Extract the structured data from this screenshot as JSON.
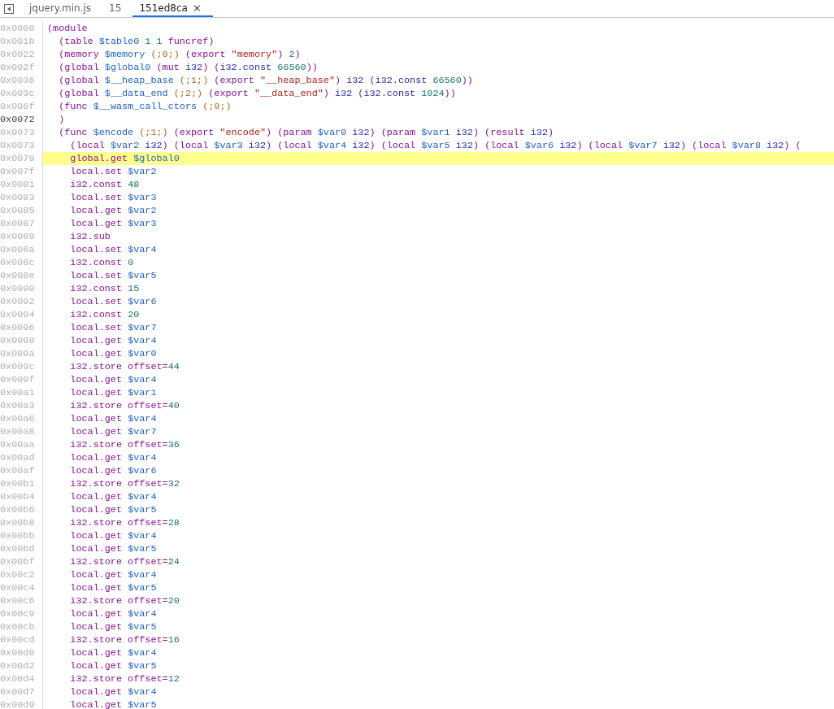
{
  "tabs": [
    {
      "label": "jquery.min.js",
      "selected": false
    },
    {
      "label": "15",
      "selected": false
    },
    {
      "label": "151ed8ca",
      "selected": true,
      "close": "×"
    }
  ],
  "code": {
    "lines": [
      {
        "addr": "0x0000",
        "dim": true,
        "current": false,
        "tokens": [
          {
            "kind": "keyword",
            "text": "(module"
          }
        ]
      },
      {
        "addr": "0x001b",
        "dim": true,
        "current": false,
        "tokens": [
          {
            "kind": "keyword",
            "text": "  (table "
          },
          {
            "kind": "name",
            "text": "$table0 "
          },
          {
            "kind": "number",
            "text": "1 1 "
          },
          {
            "kind": "keyword",
            "text": "funcref)"
          }
        ]
      },
      {
        "addr": "0x0022",
        "dim": true,
        "current": false,
        "tokens": [
          {
            "kind": "keyword",
            "text": "  (memory "
          },
          {
            "kind": "name",
            "text": "$memory "
          },
          {
            "kind": "comment",
            "text": "(;0;) "
          },
          {
            "kind": "keyword",
            "text": "(export "
          },
          {
            "kind": "string",
            "text": "\"memory\""
          },
          {
            "kind": "keyword",
            "text": ") "
          },
          {
            "kind": "number",
            "text": "2"
          },
          {
            "kind": "keyword",
            "text": ")"
          }
        ]
      },
      {
        "addr": "0x002f",
        "dim": true,
        "current": false,
        "tokens": [
          {
            "kind": "keyword",
            "text": "  (global "
          },
          {
            "kind": "name",
            "text": "$global0 "
          },
          {
            "kind": "keyword",
            "text": "(mut "
          },
          {
            "kind": "type",
            "text": "i32"
          },
          {
            "kind": "keyword",
            "text": ") ("
          },
          {
            "kind": "type",
            "text": "i32.const "
          },
          {
            "kind": "number",
            "text": "66560"
          },
          {
            "kind": "keyword",
            "text": "))"
          }
        ]
      },
      {
        "addr": "0x0036",
        "dim": true,
        "current": false,
        "tokens": [
          {
            "kind": "keyword",
            "text": "  (global "
          },
          {
            "kind": "name",
            "text": "$__heap_base "
          },
          {
            "kind": "comment",
            "text": "(;1;) "
          },
          {
            "kind": "keyword",
            "text": "(export "
          },
          {
            "kind": "string",
            "text": "\"__heap_base\""
          },
          {
            "kind": "keyword",
            "text": ") "
          },
          {
            "kind": "type",
            "text": "i32 "
          },
          {
            "kind": "keyword",
            "text": "("
          },
          {
            "kind": "type",
            "text": "i32.const "
          },
          {
            "kind": "number",
            "text": "66560"
          },
          {
            "kind": "keyword",
            "text": "))"
          }
        ]
      },
      {
        "addr": "0x003c",
        "dim": true,
        "current": false,
        "tokens": [
          {
            "kind": "keyword",
            "text": "  (global "
          },
          {
            "kind": "name",
            "text": "$__data_end "
          },
          {
            "kind": "comment",
            "text": "(;2;) "
          },
          {
            "kind": "keyword",
            "text": "(export "
          },
          {
            "kind": "string",
            "text": "\"__data_end\""
          },
          {
            "kind": "keyword",
            "text": ") "
          },
          {
            "kind": "type",
            "text": "i32 "
          },
          {
            "kind": "keyword",
            "text": "("
          },
          {
            "kind": "type",
            "text": "i32.const "
          },
          {
            "kind": "number",
            "text": "1024"
          },
          {
            "kind": "keyword",
            "text": "))"
          }
        ]
      },
      {
        "addr": "0x006f",
        "dim": true,
        "current": false,
        "tokens": [
          {
            "kind": "keyword",
            "text": "  (func "
          },
          {
            "kind": "name",
            "text": "$__wasm_call_ctors "
          },
          {
            "kind": "comment",
            "text": "(;0;)"
          }
        ]
      },
      {
        "addr": "0x0072",
        "dim": false,
        "current": false,
        "tokens": [
          {
            "kind": "keyword",
            "text": "  )"
          }
        ]
      },
      {
        "addr": "0x0073",
        "dim": true,
        "current": false,
        "tokens": [
          {
            "kind": "keyword",
            "text": "  (func "
          },
          {
            "kind": "name",
            "text": "$encode "
          },
          {
            "kind": "comment",
            "text": "(;1;) "
          },
          {
            "kind": "keyword",
            "text": "(export "
          },
          {
            "kind": "string",
            "text": "\"encode\""
          },
          {
            "kind": "keyword",
            "text": ") (param "
          },
          {
            "kind": "name",
            "text": "$var0 "
          },
          {
            "kind": "type",
            "text": "i32"
          },
          {
            "kind": "keyword",
            "text": ") (param "
          },
          {
            "kind": "name",
            "text": "$var1 "
          },
          {
            "kind": "type",
            "text": "i32"
          },
          {
            "kind": "keyword",
            "text": ") (result "
          },
          {
            "kind": "type",
            "text": "i32"
          },
          {
            "kind": "keyword",
            "text": ")"
          }
        ]
      },
      {
        "addr": "0x0073",
        "dim": true,
        "current": false,
        "tokens": [
          {
            "kind": "keyword",
            "text": "    (local "
          },
          {
            "kind": "name",
            "text": "$var2 "
          },
          {
            "kind": "type",
            "text": "i32"
          },
          {
            "kind": "keyword",
            "text": ") (local "
          },
          {
            "kind": "name",
            "text": "$var3 "
          },
          {
            "kind": "type",
            "text": "i32"
          },
          {
            "kind": "keyword",
            "text": ") (local "
          },
          {
            "kind": "name",
            "text": "$var4 "
          },
          {
            "kind": "type",
            "text": "i32"
          },
          {
            "kind": "keyword",
            "text": ") (local "
          },
          {
            "kind": "name",
            "text": "$var5 "
          },
          {
            "kind": "type",
            "text": "i32"
          },
          {
            "kind": "keyword",
            "text": ") (local "
          },
          {
            "kind": "name",
            "text": "$var6 "
          },
          {
            "kind": "type",
            "text": "i32"
          },
          {
            "kind": "keyword",
            "text": ") (local "
          },
          {
            "kind": "name",
            "text": "$var7 "
          },
          {
            "kind": "type",
            "text": "i32"
          },
          {
            "kind": "keyword",
            "text": ") (local "
          },
          {
            "kind": "name",
            "text": "$var8 "
          },
          {
            "kind": "type",
            "text": "i32"
          },
          {
            "kind": "keyword",
            "text": ") ("
          }
        ]
      },
      {
        "addr": "0x0079",
        "dim": true,
        "current": true,
        "tokens": [
          {
            "kind": "keyword",
            "text": "    global.get "
          },
          {
            "kind": "name",
            "text": "$global0"
          }
        ]
      },
      {
        "addr": "0x007f",
        "dim": true,
        "current": false,
        "tokens": [
          {
            "kind": "keyword",
            "text": "    local.set "
          },
          {
            "kind": "name",
            "text": "$var2"
          }
        ]
      },
      {
        "addr": "0x0081",
        "dim": true,
        "current": false,
        "tokens": [
          {
            "kind": "keyword",
            "text": "    i32.const "
          },
          {
            "kind": "number",
            "text": "48"
          }
        ]
      },
      {
        "addr": "0x0083",
        "dim": true,
        "current": false,
        "tokens": [
          {
            "kind": "keyword",
            "text": "    local.set "
          },
          {
            "kind": "name",
            "text": "$var3"
          }
        ]
      },
      {
        "addr": "0x0085",
        "dim": true,
        "current": false,
        "tokens": [
          {
            "kind": "keyword",
            "text": "    local.get "
          },
          {
            "kind": "name",
            "text": "$var2"
          }
        ]
      },
      {
        "addr": "0x0087",
        "dim": true,
        "current": false,
        "tokens": [
          {
            "kind": "keyword",
            "text": "    local.get "
          },
          {
            "kind": "name",
            "text": "$var3"
          }
        ]
      },
      {
        "addr": "0x0089",
        "dim": true,
        "current": false,
        "tokens": [
          {
            "kind": "keyword",
            "text": "    i32.sub"
          }
        ]
      },
      {
        "addr": "0x008a",
        "dim": true,
        "current": false,
        "tokens": [
          {
            "kind": "keyword",
            "text": "    local.set "
          },
          {
            "kind": "name",
            "text": "$var4"
          }
        ]
      },
      {
        "addr": "0x008c",
        "dim": true,
        "current": false,
        "tokens": [
          {
            "kind": "keyword",
            "text": "    i32.const "
          },
          {
            "kind": "number",
            "text": "0"
          }
        ]
      },
      {
        "addr": "0x008e",
        "dim": true,
        "current": false,
        "tokens": [
          {
            "kind": "keyword",
            "text": "    local.set "
          },
          {
            "kind": "name",
            "text": "$var5"
          }
        ]
      },
      {
        "addr": "0x0090",
        "dim": true,
        "current": false,
        "tokens": [
          {
            "kind": "keyword",
            "text": "    i32.const "
          },
          {
            "kind": "number",
            "text": "15"
          }
        ]
      },
      {
        "addr": "0x0092",
        "dim": true,
        "current": false,
        "tokens": [
          {
            "kind": "keyword",
            "text": "    local.set "
          },
          {
            "kind": "name",
            "text": "$var6"
          }
        ]
      },
      {
        "addr": "0x0094",
        "dim": true,
        "current": false,
        "tokens": [
          {
            "kind": "keyword",
            "text": "    i32.const "
          },
          {
            "kind": "number",
            "text": "20"
          }
        ]
      },
      {
        "addr": "0x0096",
        "dim": true,
        "current": false,
        "tokens": [
          {
            "kind": "keyword",
            "text": "    local.set "
          },
          {
            "kind": "name",
            "text": "$var7"
          }
        ]
      },
      {
        "addr": "0x0098",
        "dim": true,
        "current": false,
        "tokens": [
          {
            "kind": "keyword",
            "text": "    local.get "
          },
          {
            "kind": "name",
            "text": "$var4"
          }
        ]
      },
      {
        "addr": "0x009a",
        "dim": true,
        "current": false,
        "tokens": [
          {
            "kind": "keyword",
            "text": "    local.get "
          },
          {
            "kind": "name",
            "text": "$var0"
          }
        ]
      },
      {
        "addr": "0x009c",
        "dim": true,
        "current": false,
        "tokens": [
          {
            "kind": "keyword",
            "text": "    i32.store offset="
          },
          {
            "kind": "number",
            "text": "44"
          }
        ]
      },
      {
        "addr": "0x009f",
        "dim": true,
        "current": false,
        "tokens": [
          {
            "kind": "keyword",
            "text": "    local.get "
          },
          {
            "kind": "name",
            "text": "$var4"
          }
        ]
      },
      {
        "addr": "0x00a1",
        "dim": true,
        "current": false,
        "tokens": [
          {
            "kind": "keyword",
            "text": "    local.get "
          },
          {
            "kind": "name",
            "text": "$var1"
          }
        ]
      },
      {
        "addr": "0x00a3",
        "dim": true,
        "current": false,
        "tokens": [
          {
            "kind": "keyword",
            "text": "    i32.store offset="
          },
          {
            "kind": "number",
            "text": "40"
          }
        ]
      },
      {
        "addr": "0x00a6",
        "dim": true,
        "current": false,
        "tokens": [
          {
            "kind": "keyword",
            "text": "    local.get "
          },
          {
            "kind": "name",
            "text": "$var4"
          }
        ]
      },
      {
        "addr": "0x00a8",
        "dim": true,
        "current": false,
        "tokens": [
          {
            "kind": "keyword",
            "text": "    local.get "
          },
          {
            "kind": "name",
            "text": "$var7"
          }
        ]
      },
      {
        "addr": "0x00aa",
        "dim": true,
        "current": false,
        "tokens": [
          {
            "kind": "keyword",
            "text": "    i32.store offset="
          },
          {
            "kind": "number",
            "text": "36"
          }
        ]
      },
      {
        "addr": "0x00ad",
        "dim": true,
        "current": false,
        "tokens": [
          {
            "kind": "keyword",
            "text": "    local.get "
          },
          {
            "kind": "name",
            "text": "$var4"
          }
        ]
      },
      {
        "addr": "0x00af",
        "dim": true,
        "current": false,
        "tokens": [
          {
            "kind": "keyword",
            "text": "    local.get "
          },
          {
            "kind": "name",
            "text": "$var6"
          }
        ]
      },
      {
        "addr": "0x00b1",
        "dim": true,
        "current": false,
        "tokens": [
          {
            "kind": "keyword",
            "text": "    i32.store offset="
          },
          {
            "kind": "number",
            "text": "32"
          }
        ]
      },
      {
        "addr": "0x00b4",
        "dim": true,
        "current": false,
        "tokens": [
          {
            "kind": "keyword",
            "text": "    local.get "
          },
          {
            "kind": "name",
            "text": "$var4"
          }
        ]
      },
      {
        "addr": "0x00b6",
        "dim": true,
        "current": false,
        "tokens": [
          {
            "kind": "keyword",
            "text": "    local.get "
          },
          {
            "kind": "name",
            "text": "$var5"
          }
        ]
      },
      {
        "addr": "0x00b8",
        "dim": true,
        "current": false,
        "tokens": [
          {
            "kind": "keyword",
            "text": "    i32.store offset="
          },
          {
            "kind": "number",
            "text": "28"
          }
        ]
      },
      {
        "addr": "0x00bb",
        "dim": true,
        "current": false,
        "tokens": [
          {
            "kind": "keyword",
            "text": "    local.get "
          },
          {
            "kind": "name",
            "text": "$var4"
          }
        ]
      },
      {
        "addr": "0x00bd",
        "dim": true,
        "current": false,
        "tokens": [
          {
            "kind": "keyword",
            "text": "    local.get "
          },
          {
            "kind": "name",
            "text": "$var5"
          }
        ]
      },
      {
        "addr": "0x00bf",
        "dim": true,
        "current": false,
        "tokens": [
          {
            "kind": "keyword",
            "text": "    i32.store offset="
          },
          {
            "kind": "number",
            "text": "24"
          }
        ]
      },
      {
        "addr": "0x00c2",
        "dim": true,
        "current": false,
        "tokens": [
          {
            "kind": "keyword",
            "text": "    local.get "
          },
          {
            "kind": "name",
            "text": "$var4"
          }
        ]
      },
      {
        "addr": "0x00c4",
        "dim": true,
        "current": false,
        "tokens": [
          {
            "kind": "keyword",
            "text": "    local.get "
          },
          {
            "kind": "name",
            "text": "$var5"
          }
        ]
      },
      {
        "addr": "0x00c6",
        "dim": true,
        "current": false,
        "tokens": [
          {
            "kind": "keyword",
            "text": "    i32.store offset="
          },
          {
            "kind": "number",
            "text": "20"
          }
        ]
      },
      {
        "addr": "0x00c9",
        "dim": true,
        "current": false,
        "tokens": [
          {
            "kind": "keyword",
            "text": "    local.get "
          },
          {
            "kind": "name",
            "text": "$var4"
          }
        ]
      },
      {
        "addr": "0x00cb",
        "dim": true,
        "current": false,
        "tokens": [
          {
            "kind": "keyword",
            "text": "    local.get "
          },
          {
            "kind": "name",
            "text": "$var5"
          }
        ]
      },
      {
        "addr": "0x00cd",
        "dim": true,
        "current": false,
        "tokens": [
          {
            "kind": "keyword",
            "text": "    i32.store offset="
          },
          {
            "kind": "number",
            "text": "16"
          }
        ]
      },
      {
        "addr": "0x00d0",
        "dim": true,
        "current": false,
        "tokens": [
          {
            "kind": "keyword",
            "text": "    local.get "
          },
          {
            "kind": "name",
            "text": "$var4"
          }
        ]
      },
      {
        "addr": "0x00d2",
        "dim": true,
        "current": false,
        "tokens": [
          {
            "kind": "keyword",
            "text": "    local.get "
          },
          {
            "kind": "name",
            "text": "$var5"
          }
        ]
      },
      {
        "addr": "0x00d4",
        "dim": true,
        "current": false,
        "tokens": [
          {
            "kind": "keyword",
            "text": "    i32.store offset="
          },
          {
            "kind": "number",
            "text": "12"
          }
        ]
      },
      {
        "addr": "0x00d7",
        "dim": true,
        "current": false,
        "tokens": [
          {
            "kind": "keyword",
            "text": "    local.get "
          },
          {
            "kind": "name",
            "text": "$var4"
          }
        ]
      },
      {
        "addr": "0x00d9",
        "dim": true,
        "current": false,
        "tokens": [
          {
            "kind": "keyword",
            "text": "    local.get "
          },
          {
            "kind": "name",
            "text": "$var5"
          }
        ]
      }
    ]
  }
}
